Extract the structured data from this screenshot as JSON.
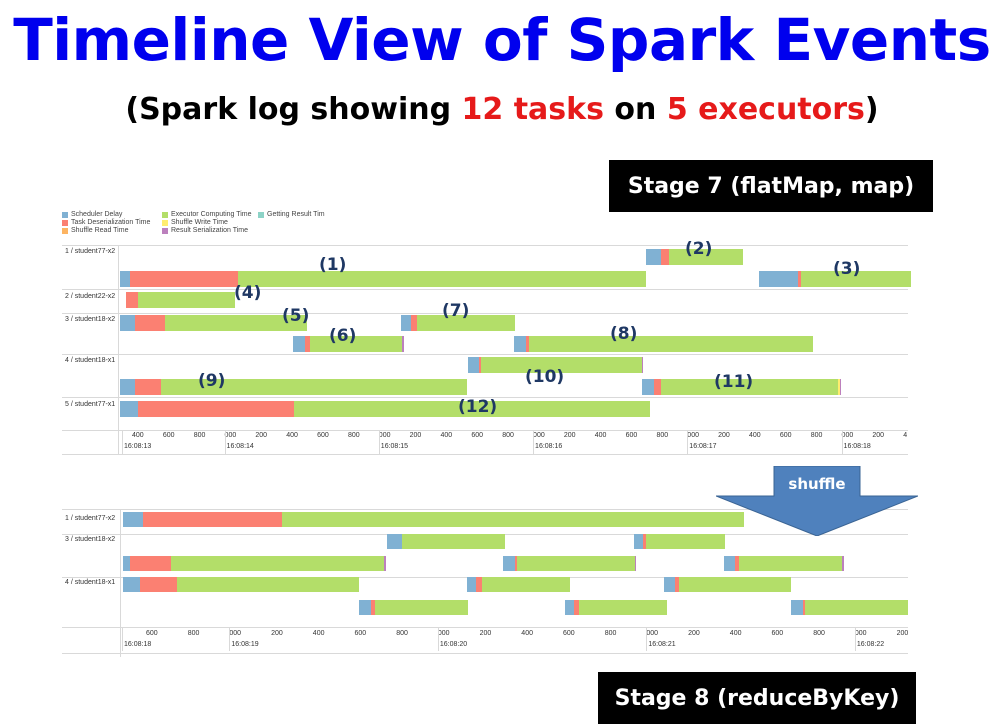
{
  "title": "Timeline View of Spark Events",
  "subtitle": {
    "prefix": "(Spark log showing ",
    "tasks": "12 tasks",
    "middle": " on ",
    "executors": "5 executors",
    "suffix": ")"
  },
  "stage7_label": "Stage 7 (flatMap, map)",
  "stage8_label": "Stage 8 (reduceByKey)",
  "shuffle_label": "shuffle",
  "colors": {
    "scheduler_delay": "#80b1d3",
    "task_deserialization": "#fb8072",
    "shuffle_read": "#fdb462",
    "executor_computing": "#b3de69",
    "shuffle_write": "#ffed6f",
    "result_serialization": "#bc80bd",
    "getting_result": "#8dd3c7",
    "title": "#0000ee",
    "highlight": "#e61a1a",
    "task_label": "#1f3864",
    "arrow": "#4f81bd"
  },
  "legend": [
    {
      "label": "Scheduler Delay",
      "color": "#80b1d3"
    },
    {
      "label": "Task Deserialization Time",
      "color": "#fb8072"
    },
    {
      "label": "Shuffle Read Time",
      "color": "#fdb462"
    },
    {
      "label": "Executor Computing Time",
      "color": "#b3de69"
    },
    {
      "label": "Shuffle Write Time",
      "color": "#ffed6f"
    },
    {
      "label": "Result Serialization Time",
      "color": "#bc80bd"
    },
    {
      "label": "Getting Result Tim",
      "color": "#8dd3c7"
    }
  ],
  "stage7": {
    "executors": [
      "1 / student77-x2",
      "2 / student22-x2",
      "3 / student18-x2",
      "4 / student18-x1",
      "5 / student77-x1"
    ],
    "ticks": [
      "400",
      "600",
      "800",
      "000",
      "200",
      "400",
      "600",
      "800",
      "000",
      "200",
      "400",
      "600",
      "800",
      "000",
      "200",
      "400",
      "600",
      "800",
      "000",
      "200",
      "400",
      "600",
      "800",
      "000",
      "200",
      "4"
    ],
    "times": [
      "16:08:13",
      "16:08:14",
      "16:08:15",
      "16:08:16",
      "16:08:17",
      "16:08:18"
    ],
    "task_labels": [
      "(1)",
      "(2)",
      "(3)",
      "(4)",
      "(5)",
      "(6)",
      "(7)",
      "(8)",
      "(9)",
      "(10)",
      "(11)",
      "(12)"
    ]
  },
  "stage8": {
    "executors": [
      "1 / student77-x2",
      "3 / student18-x2",
      "4 / student18-x1"
    ],
    "ticks": [
      "600",
      "800",
      "000",
      "200",
      "400",
      "600",
      "800",
      "000",
      "200",
      "400",
      "600",
      "800",
      "000",
      "200",
      "400",
      "600",
      "800",
      "000",
      "200"
    ],
    "times": [
      "16:08:18",
      "16:08:19",
      "16:08:20",
      "16:08:21",
      "16:08:22"
    ]
  }
}
